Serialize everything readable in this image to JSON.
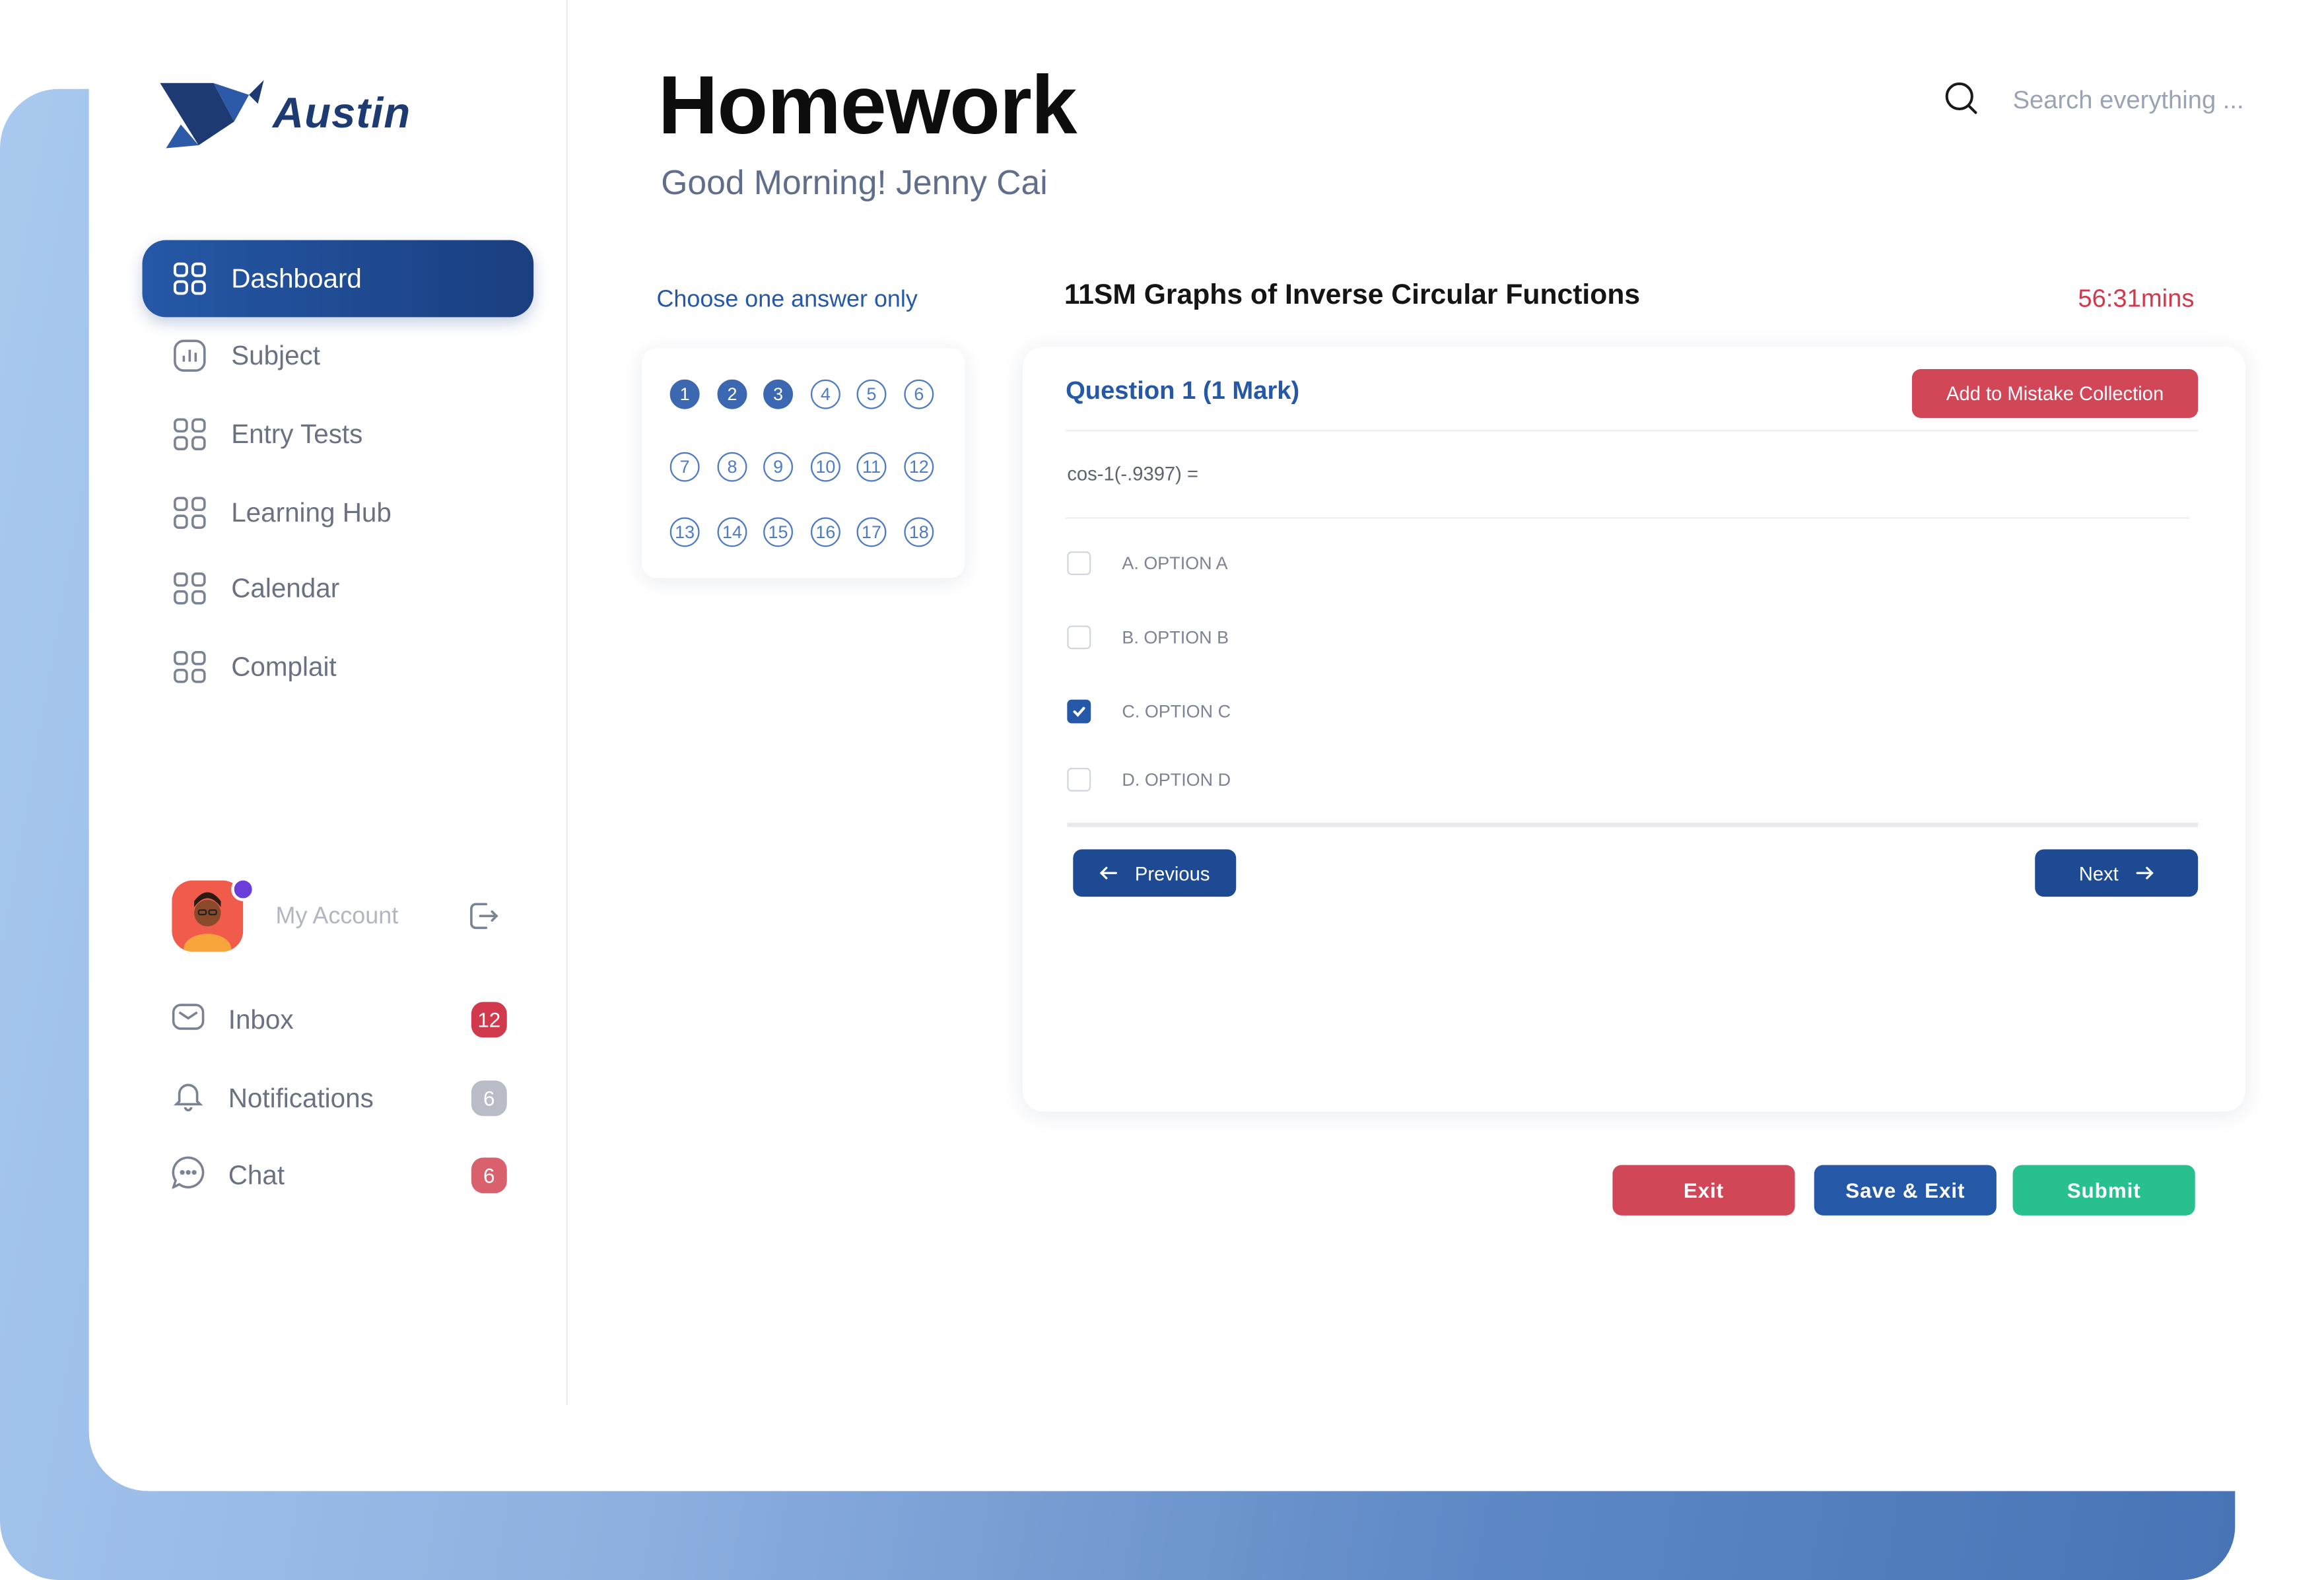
{
  "brand": {
    "name": "Austin"
  },
  "sidebar": {
    "nav": [
      {
        "label": "Dashboard",
        "icon": "grid-icon",
        "active": true
      },
      {
        "label": "Subject",
        "icon": "chart-icon"
      },
      {
        "label": "Entry Tests",
        "icon": "grid-icon"
      },
      {
        "label": "Learning Hub",
        "icon": "grid-icon"
      },
      {
        "label": "Calendar",
        "icon": "grid-icon"
      },
      {
        "label": "Complait",
        "icon": "grid-icon"
      }
    ],
    "account": {
      "label": "My Account"
    },
    "messages": [
      {
        "label": "Inbox",
        "icon": "mail-icon",
        "count": "12",
        "color": "#d03a4c"
      },
      {
        "label": "Notifications",
        "icon": "bell-icon",
        "count": "6",
        "color": "#b9bcc6"
      },
      {
        "label": "Chat",
        "icon": "chat-icon",
        "count": "6",
        "color": "#d9616e"
      }
    ]
  },
  "header": {
    "title": "Homework",
    "greeting": "Good Morning! Jenny Cai",
    "search_placeholder": "Search everything ..."
  },
  "question_nav": {
    "instruction": "Choose one answer only",
    "numbers": [
      "1",
      "2",
      "3",
      "4",
      "5",
      "6",
      "7",
      "8",
      "9",
      "10",
      "11",
      "12",
      "13",
      "14",
      "15",
      "16",
      "17",
      "18"
    ],
    "answered": [
      "1",
      "2",
      "3"
    ]
  },
  "quiz": {
    "title": "11SM Graphs of Inverse Circular Functions",
    "timer": "56:31mins",
    "question_label": "Question 1  (1 Mark)",
    "mistake_button": "Add to Mistake Collection",
    "formula": "cos-1(-.9397) =",
    "options": [
      {
        "label": "A. OPTION A",
        "checked": false
      },
      {
        "label": "B. OPTION B",
        "checked": false
      },
      {
        "label": "C. OPTION C",
        "checked": true
      },
      {
        "label": "D. OPTION D",
        "checked": false
      }
    ],
    "previous_label": "Previous",
    "next_label": "Next"
  },
  "actions": {
    "exit": "Exit",
    "save_exit": "Save & Exit",
    "submit": "Submit"
  },
  "colors": {
    "primary": "#1e4a94",
    "danger": "#d14758",
    "success": "#27c08e",
    "accent_blue": "#2558a7"
  }
}
